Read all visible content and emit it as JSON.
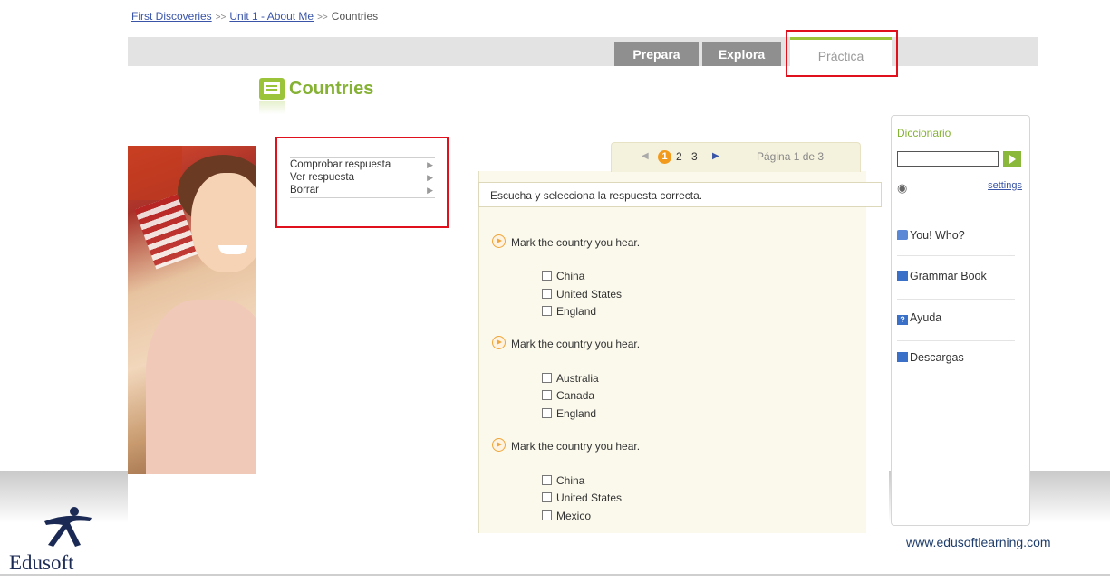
{
  "breadcrumb": {
    "items": [
      "First Discoveries",
      "Unit 1 - About Me",
      "Countries"
    ],
    "separator": ">>"
  },
  "tabs": [
    {
      "label": "Prepara",
      "active": false
    },
    {
      "label": "Explora",
      "active": false
    },
    {
      "label": "Práctica",
      "active": true
    }
  ],
  "page_title": "Countries",
  "options_menu": [
    "Comprobar respuesta",
    "Ver respuesta",
    "Borrar"
  ],
  "pager": {
    "pages": [
      "1",
      "2",
      "3"
    ],
    "current": "1",
    "info": "Página 1 de 3"
  },
  "exercise": {
    "instruction": "Escucha y selecciona la respuesta correcta.",
    "questions": [
      {
        "prompt": "Mark the country you hear.",
        "choices": [
          "China",
          "United States",
          "England"
        ]
      },
      {
        "prompt": "Mark the country you hear.",
        "choices": [
          "Australia",
          "Canada",
          "England"
        ]
      },
      {
        "prompt": "Mark the country you hear.",
        "choices": [
          "China",
          "United States",
          "Mexico"
        ]
      }
    ]
  },
  "sidebar": {
    "dictionary_label": "Diccionario",
    "dictionary_value": "",
    "settings_label": "settings",
    "links": [
      "You! Who?",
      "Grammar Book",
      "Ayuda",
      "Descargas"
    ]
  },
  "footer": {
    "url": "www.edusoftlearning.com",
    "brand": "Edusoft"
  },
  "colors": {
    "accent_green": "#85b234",
    "tab_gray": "#8f8f8f",
    "highlight_red": "#e0101c",
    "link_blue": "#3a55a8"
  }
}
